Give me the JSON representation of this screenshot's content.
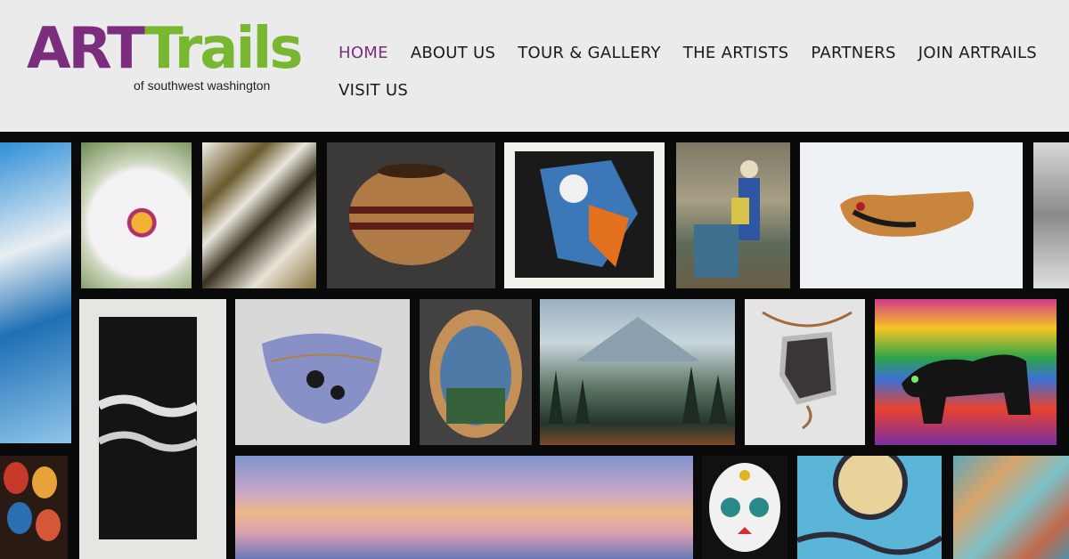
{
  "logo": {
    "word_art": "ART",
    "word_trails": "Trails",
    "subtitle": "of southwest washington",
    "brand_purple": "#7c2d7e",
    "brand_green": "#7ab730"
  },
  "nav": {
    "items": [
      {
        "label": "HOME",
        "active": true
      },
      {
        "label": "ABOUT US"
      },
      {
        "label": "TOUR & GALLERY"
      },
      {
        "label": "THE ARTISTS"
      },
      {
        "label": "PARTNERS"
      },
      {
        "label": "JOIN ARTRAILS"
      },
      {
        "label": "VISIT US"
      }
    ]
  }
}
